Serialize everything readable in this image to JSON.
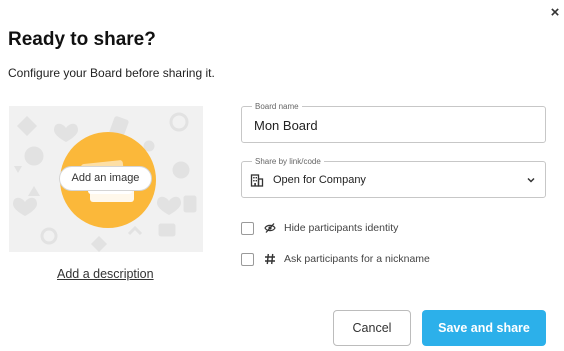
{
  "dialog": {
    "close_symbol": "×",
    "title": "Ready to share?",
    "subtitle": "Configure your Board before sharing it."
  },
  "media": {
    "add_image_label": "Add an image",
    "add_description_label": "Add a description",
    "accent_color": "#fbb83a"
  },
  "fields": {
    "board_name_label": "Board name",
    "board_name_value": "Mon Board",
    "share_label": "Share by link/code",
    "share_value": "Open for Company",
    "share_icon": "building-icon"
  },
  "options": [
    {
      "label": "Hide participants identity",
      "icon": "eye-off-icon",
      "checked": false
    },
    {
      "label": "Ask participants for a nickname",
      "icon": "hash-icon",
      "checked": false
    }
  ],
  "actions": {
    "cancel_label": "Cancel",
    "save_label": "Save and share",
    "primary_color": "#2cb0ea"
  }
}
